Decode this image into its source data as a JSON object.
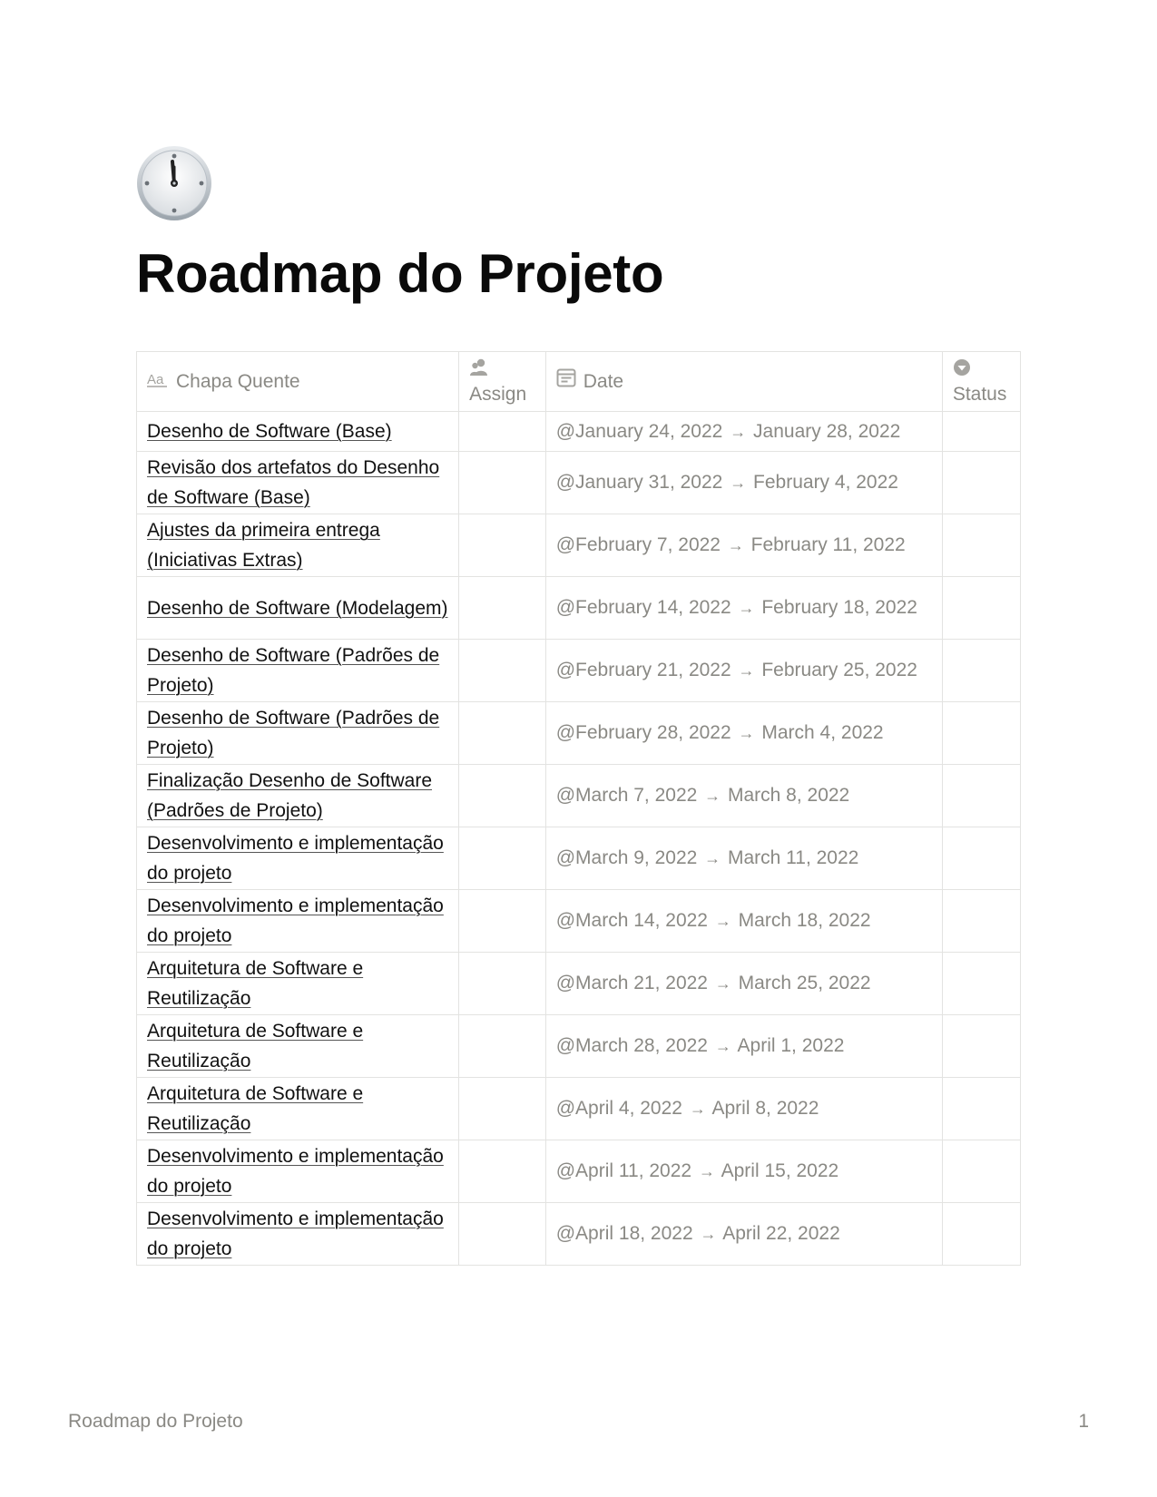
{
  "page": {
    "icon": "clock-emoji-icon",
    "title": "Roadmap do Projeto"
  },
  "table": {
    "columns": [
      {
        "label": "Chapa Quente",
        "icon": "text-property-icon"
      },
      {
        "label": "Assign",
        "icon": "person-property-icon"
      },
      {
        "label": "Date",
        "icon": "calendar-property-icon"
      },
      {
        "label": "Status",
        "icon": "select-property-icon"
      }
    ],
    "rows": [
      {
        "name": "Desenho de Software (Base)",
        "start": "@January 24, 2022",
        "arrow": "→",
        "end": "January 28, 2022",
        "assign": "",
        "status": ""
      },
      {
        "name": "Revisão dos artefatos do Desenho de Software (Base)",
        "start": "@January 31, 2022",
        "arrow": "→",
        "end": "February 4, 2022",
        "assign": "",
        "status": ""
      },
      {
        "name": "Ajustes da primeira entrega (Iniciativas Extras)",
        "start": "@February 7, 2022",
        "arrow": "→",
        "end": "February 11, 2022",
        "assign": "",
        "status": ""
      },
      {
        "name": "Desenho de Software (Modelagem)",
        "start": "@February 14, 2022",
        "arrow": "→",
        "end": "February 18, 2022",
        "assign": "",
        "status": ""
      },
      {
        "name": "Desenho de Software (Padrões de Projeto)",
        "start": "@February 21, 2022",
        "arrow": "→",
        "end": "February 25, 2022",
        "assign": "",
        "status": ""
      },
      {
        "name": "Desenho de Software (Padrões de Projeto)",
        "start": "@February 28, 2022",
        "arrow": "→",
        "end": "March 4, 2022",
        "assign": "",
        "status": ""
      },
      {
        "name": "Finalização Desenho de Software (Padrões de Projeto)",
        "start": "@March 7, 2022",
        "arrow": "→",
        "end": "March 8, 2022",
        "assign": "",
        "status": ""
      },
      {
        "name": "Desenvolvimento e implementação do projeto",
        "start": "@March 9, 2022",
        "arrow": "→",
        "end": "March 11, 2022",
        "assign": "",
        "status": ""
      },
      {
        "name": "Desenvolvimento e implementação do projeto",
        "start": "@March 14, 2022",
        "arrow": "→",
        "end": "March 18, 2022",
        "assign": "",
        "status": ""
      },
      {
        "name": "Arquitetura de Software e Reutilização",
        "start": "@March 21, 2022",
        "arrow": "→",
        "end": "March 25, 2022",
        "assign": "",
        "status": ""
      },
      {
        "name": "Arquitetura de Software e Reutilização",
        "start": "@March 28, 2022",
        "arrow": "→",
        "end": "April 1, 2022",
        "assign": "",
        "status": ""
      },
      {
        "name": "Arquitetura de Software e Reutilização",
        "start": "@April 4, 2022",
        "arrow": "→",
        "end": "April 8, 2022",
        "assign": "",
        "status": ""
      },
      {
        "name": "Desenvolvimento e implementação do projeto",
        "start": "@April 11, 2022",
        "arrow": "→",
        "end": "April 15, 2022",
        "assign": "",
        "status": ""
      },
      {
        "name": "Desenvolvimento e implementação do projeto",
        "start": "@April 18, 2022",
        "arrow": "→",
        "end": "April 22, 2022",
        "assign": "",
        "status": ""
      }
    ]
  },
  "footer": {
    "title": "Roadmap do Projeto",
    "page_number": "1"
  },
  "colors": {
    "text": "#111111",
    "muted": "#8a8984",
    "border": "#e3e3e1"
  }
}
